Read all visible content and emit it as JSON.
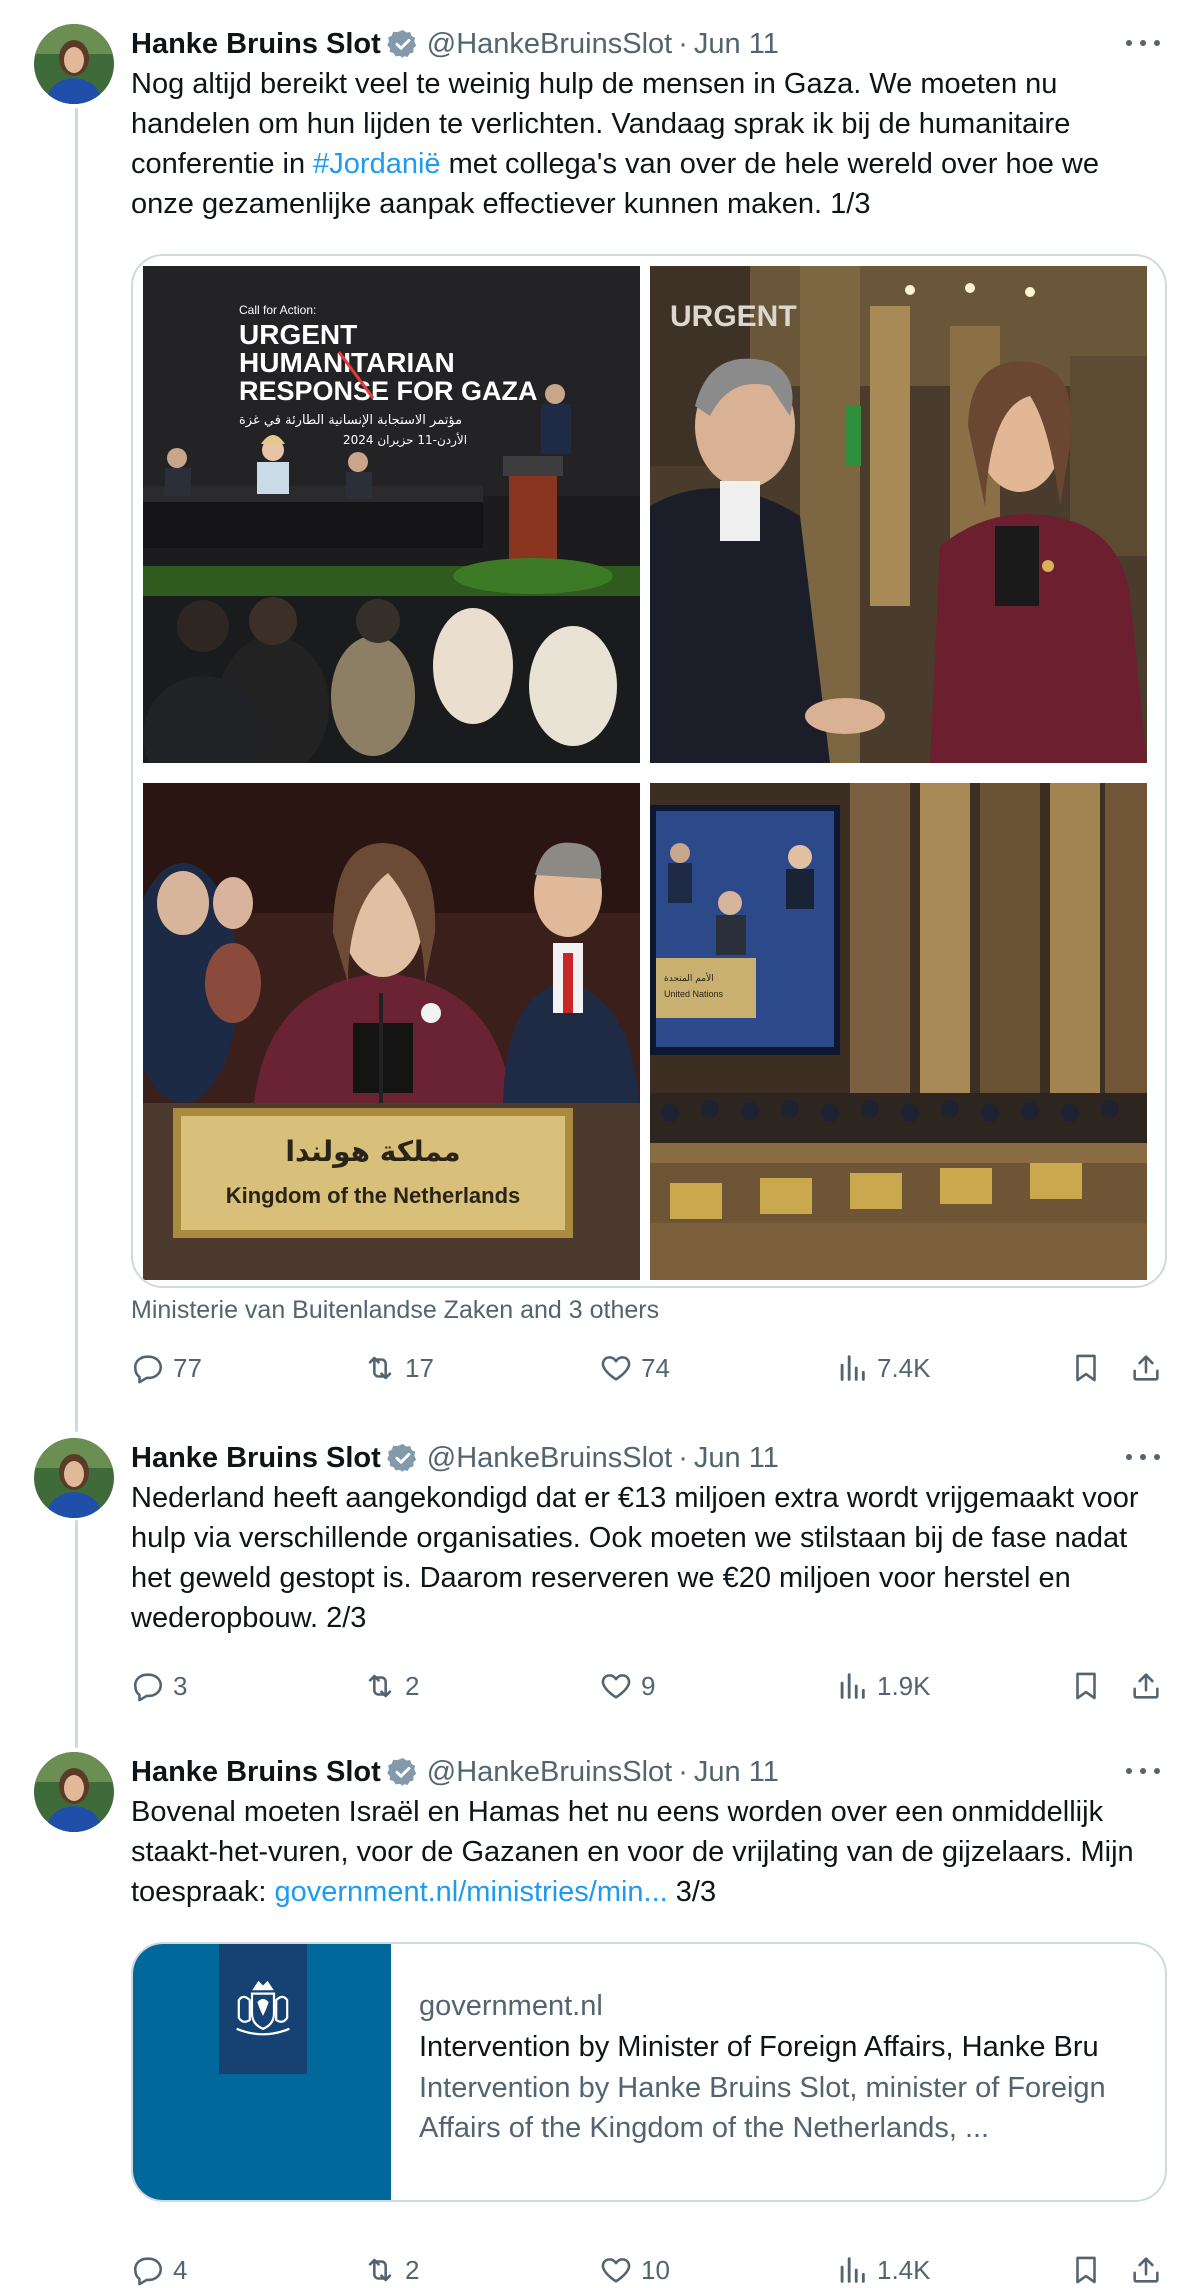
{
  "author": {
    "name": "Hanke Bruins Slot",
    "handle": "@HankeBruinsSlot",
    "separator": "·",
    "date": "Jun 11",
    "verified_color": "#829aab"
  },
  "icons": {
    "more": "more-icon",
    "verified": "verified-badge-icon",
    "reply": "reply-icon",
    "repost": "repost-icon",
    "like": "heart-icon",
    "views": "views-chart-icon",
    "bookmark": "bookmark-icon",
    "share": "share-icon",
    "crest": "coat-of-arms-icon"
  },
  "colors": {
    "link": "#1d9bf0",
    "muted": "#536471",
    "text": "#0f1419",
    "thumb_bg": "#01689b",
    "logo_bg": "#154273"
  },
  "tweets": [
    {
      "text_before_link": "Nog altijd bereikt veel te weinig hulp de mensen in Gaza. We moeten nu handelen om hun lijden te verlichten. Vandaag sprak ik bij de humanitaire conferentie in ",
      "hashtag": "#Jordanië",
      "text_after_link": " met collega's van over de hele wereld over hoe we onze gezamenlijke aanpak effectiever kunnen maken. 1/3",
      "photos": {
        "photo1": {
          "small": "Call for Action:",
          "line1": "URGENT",
          "line2": "HUMANITARIAN",
          "line3": "RESPONSE FOR GAZA",
          "arabic": "مؤتمر الاستجابة الإنسانية الطارئة في غزة",
          "arabic_date": "الأردن-11 حزيران 2024"
        },
        "photo3": {
          "arabic": "مملكة هولندا",
          "plate": "Kingdom of the Netherlands"
        },
        "photo4": {
          "screen_label_ar": "الأمم المتحدة",
          "screen_label": "United Nations"
        }
      },
      "social_context": "Ministerie van Buitenlandse Zaken and 3 others",
      "stats": {
        "replies": "77",
        "reposts": "17",
        "likes": "74",
        "views": "7.4K"
      }
    },
    {
      "text": "Nederland heeft aangekondigd dat er €13 miljoen extra wordt vrijgemaakt voor hulp via verschillende organisaties. Ook moeten we stilstaan bij de fase nadat het geweld gestopt is. Daarom reserveren we €20 miljoen voor herstel en wederopbouw. 2/3",
      "stats": {
        "replies": "3",
        "reposts": "2",
        "likes": "9",
        "views": "1.9K"
      }
    },
    {
      "text_before_link": "Bovenal moeten Israël en Hamas het nu eens worden over een onmiddellijk staakt-het-vuren, voor de Gazanen en voor de vrijlating van de gijzelaars. Mijn toespraak: ",
      "link": "government.nl/ministries/min...",
      "text_after_link": " 3/3",
      "card": {
        "domain": "government.nl",
        "title": "Intervention by Minister of Foreign Affairs, Hanke Bru",
        "description": "Intervention by Hanke Bruins Slot, minister of Foreign Affairs of the Kingdom of the Netherlands, ..."
      },
      "stats": {
        "replies": "4",
        "reposts": "2",
        "likes": "10",
        "views": "1.4K"
      }
    }
  ]
}
